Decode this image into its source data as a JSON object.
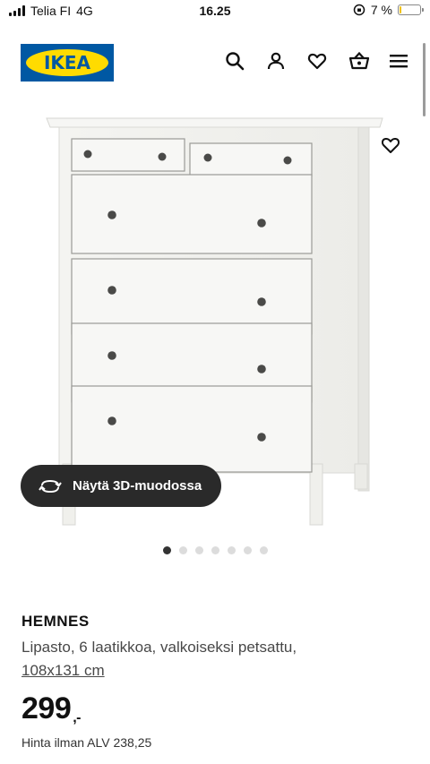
{
  "status_bar": {
    "carrier": "Telia FI",
    "network": "4G",
    "time": "16.25",
    "battery_percent": "7 %",
    "battery_level": 0.07,
    "battery_color": "#f2c200"
  },
  "header": {
    "logo_text": "IKEA",
    "brand_blue": "#0058a3",
    "brand_yellow": "#ffdb00",
    "icons": [
      "search-icon",
      "account-icon",
      "heart-icon",
      "basket-icon",
      "menu-icon"
    ]
  },
  "gallery": {
    "view_3d_label": "Näytä 3D-muodossa",
    "image_count": 7,
    "active_index": 0
  },
  "product": {
    "name": "HEMNES",
    "description": "Lipasto, 6 laatikkoa, valkoiseksi petsattu,",
    "dimensions": "108x131 cm",
    "price_integer": "299",
    "price_decimal": ",-",
    "price_excl_vat": "Hinta ilman ALV 238,25"
  }
}
